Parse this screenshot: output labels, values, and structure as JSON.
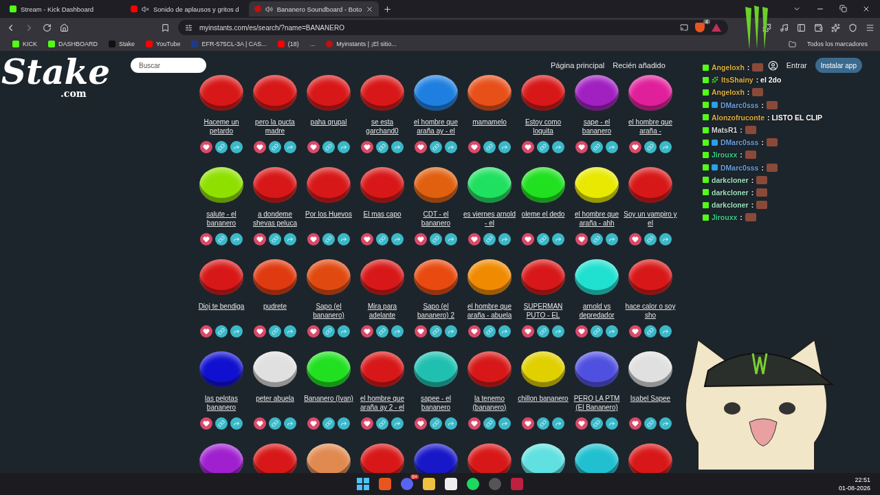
{
  "browser": {
    "tabs": [
      {
        "title": "Stream - Kick Dashboard",
        "kind": "kick",
        "muted": false,
        "playing": false,
        "selected": false
      },
      {
        "title": "Sonido de aplausos y gritos d",
        "kind": "youtube",
        "muted": true,
        "playing": false,
        "selected": false
      },
      {
        "title": "Bananero Soundboard - Boto",
        "kind": "myinstants",
        "muted": false,
        "playing": true,
        "selected": true
      }
    ],
    "url": "myinstants.com/es/search/?name=BANANERO",
    "shield_count": "4",
    "bookmarks": [
      {
        "label": "KICK",
        "kind": "kick"
      },
      {
        "label": "DASHBOARD",
        "kind": "kick"
      },
      {
        "label": "Stake",
        "kind": "stake"
      },
      {
        "label": "YouTube",
        "kind": "youtube"
      },
      {
        "label": "EFR-575CL-3A | CAS...",
        "kind": "watch"
      },
      {
        "label": "(18)",
        "kind": "youtube"
      },
      {
        "label": "...",
        "kind": "none"
      },
      {
        "label": "Myinstants | ¡El sitio...",
        "kind": "myinstants"
      }
    ],
    "all_bookmarks": "Todos los marcadores"
  },
  "site": {
    "search": {
      "placeholder": "Buscar"
    },
    "nav": [
      "Página principal",
      "Recién añadido"
    ],
    "login": "Entrar",
    "install": "Instalar app"
  },
  "sounds": [
    {
      "label": "Haceme un petardo",
      "color": "#d81818"
    },
    {
      "label": "pero la pucta madre",
      "color": "#d81818"
    },
    {
      "label": "paha grupal",
      "color": "#d81818"
    },
    {
      "label": "se esta garchand0",
      "color": "#d81818"
    },
    {
      "label": "el hombre que araña ay - el",
      "color": "#1e7fe0"
    },
    {
      "label": "mamamelo",
      "color": "#e8501a"
    },
    {
      "label": "Estoy como loquita",
      "color": "#d81818"
    },
    {
      "label": "sape - el bananero",
      "color": "#a020c0"
    },
    {
      "label": "el hombre que araña -",
      "color": "#e0209a"
    },
    {
      "label": "salute - el bananero",
      "color": "#8fe000"
    },
    {
      "label": "a dondeme shevas peluca",
      "color": "#d81818"
    },
    {
      "label": "Por los Huevos",
      "color": "#d81818"
    },
    {
      "label": "El mas capo",
      "color": "#d81818"
    },
    {
      "label": "CDT - el bananero",
      "color": "#e06010"
    },
    {
      "label": "es viernes arnold - el",
      "color": "#20e060"
    },
    {
      "label": "oleme el dedo",
      "color": "#20e020"
    },
    {
      "label": "el hombre que araña - ahh",
      "color": "#e8e800"
    },
    {
      "label": "Soy un vampiro y el",
      "color": "#d81818"
    },
    {
      "label": "Dioj te bendiga",
      "color": "#d81818"
    },
    {
      "label": "pudrete",
      "color": "#e03a10"
    },
    {
      "label": "Sapo (el bananero)",
      "color": "#e04a10"
    },
    {
      "label": "Mira para adelante",
      "color": "#d81818"
    },
    {
      "label": "Sapo (el bananero) 2",
      "color": "#e84a10"
    },
    {
      "label": "el hombre que araña - abuela",
      "color": "#f08a00"
    },
    {
      "label": "SUPERMAN PUTO - EL",
      "color": "#d81818"
    },
    {
      "label": "arnold vs depredador",
      "color": "#20e0d0"
    },
    {
      "label": "hace calor o soy sho",
      "color": "#d81818"
    },
    {
      "label": "las pelotas bananero",
      "color": "#1010d0"
    },
    {
      "label": "peter abuela",
      "color": "#e0e0e0"
    },
    {
      "label": "Bananero (Ivan)",
      "color": "#20e020"
    },
    {
      "label": "el hombre que araña ay 2 - el",
      "color": "#d81818"
    },
    {
      "label": "sapee - el bananero",
      "color": "#20c0b0"
    },
    {
      "label": "la tenemo (bananero)",
      "color": "#d81818"
    },
    {
      "label": "chillon bananero",
      "color": "#e0d000"
    },
    {
      "label": "PERO LA PTM (El Bananero)",
      "color": "#5050e0"
    },
    {
      "label": "Isabel Sapee",
      "color": "#e0e0e0"
    }
  ],
  "sounds_cut": [
    {
      "color": "#a020d0"
    },
    {
      "color": "#d81818"
    },
    {
      "color": "#e08a50"
    },
    {
      "color": "#d81818"
    },
    {
      "color": "#1818c8"
    },
    {
      "color": "#d81818"
    },
    {
      "color": "#60e0e0"
    },
    {
      "color": "#20c0d0"
    },
    {
      "color": "#d81818"
    }
  ],
  "stream_overlay": {
    "logo": "Stake",
    "logo_suffix": ".com",
    "chat": [
      {
        "user": "Angeloxh",
        "color": "#e0b040",
        "sparkle_badge": false,
        "cube_badge": false,
        "kind": "emote",
        "message": ":"
      },
      {
        "user": "ItsShainy",
        "color": "#e0b040",
        "sparkle_badge": true,
        "cube_badge": false,
        "kind": "text",
        "message": ": el 2do"
      },
      {
        "user": "Angeloxh",
        "color": "#e0b040",
        "sparkle_badge": false,
        "cube_badge": false,
        "kind": "emote",
        "message": ":"
      },
      {
        "user": "DMarc0sss",
        "color": "#6aa0e0",
        "sparkle_badge": false,
        "cube_badge": true,
        "kind": "emote",
        "message": ":"
      },
      {
        "user": "Alonzofruconte",
        "color": "#e0b040",
        "sparkle_badge": false,
        "cube_badge": false,
        "kind": "text",
        "message": ": LISTO EL CLIP"
      },
      {
        "user": "MatsR1",
        "color": "#d8d8d8",
        "sparkle_badge": false,
        "cube_badge": false,
        "kind": "emote",
        "message": ":"
      },
      {
        "user": "DMarc0sss",
        "color": "#6aa0e0",
        "sparkle_badge": false,
        "cube_badge": true,
        "kind": "emote",
        "message": ":"
      },
      {
        "user": "Jirouxx",
        "color": "#3ad08a",
        "sparkle_badge": false,
        "cube_badge": false,
        "kind": "emote",
        "message": ":"
      },
      {
        "user": "DMarc0sss",
        "color": "#6aa0e0",
        "sparkle_badge": false,
        "cube_badge": true,
        "kind": "emote",
        "message": ":"
      },
      {
        "user": "darkcloner",
        "color": "#a0e0c0",
        "sparkle_badge": false,
        "cube_badge": false,
        "kind": "emote",
        "message": ":"
      },
      {
        "user": "darkcloner",
        "color": "#a0e0c0",
        "sparkle_badge": false,
        "cube_badge": false,
        "kind": "emote",
        "message": ":"
      },
      {
        "user": "darkcloner",
        "color": "#a0e0c0",
        "sparkle_badge": false,
        "cube_badge": false,
        "kind": "emote",
        "message": ":"
      },
      {
        "user": "Jirouxx",
        "color": "#3ad08a",
        "sparkle_badge": false,
        "cube_badge": false,
        "kind": "emote",
        "message": ":"
      }
    ]
  },
  "taskbar": {
    "discord_badge": "9+",
    "time": "22:51",
    "date": "01-08-2026"
  }
}
